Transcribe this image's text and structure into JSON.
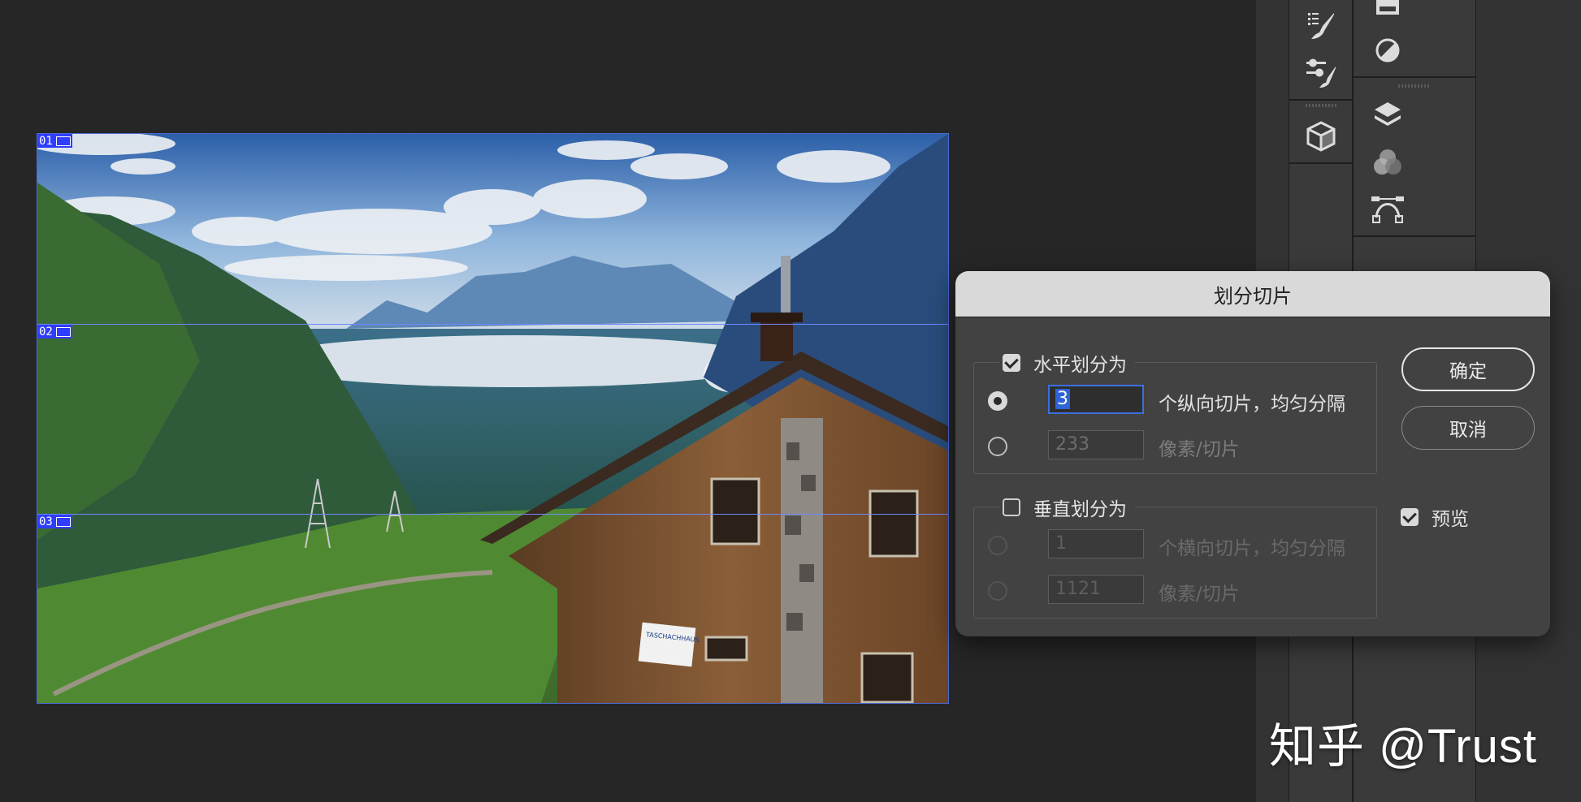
{
  "canvas": {
    "slices": [
      {
        "label": "01"
      },
      {
        "label": "02"
      },
      {
        "label": "03"
      }
    ],
    "sign_text": "TASCHACHHAUS"
  },
  "dialog": {
    "title": "划分切片",
    "horizontal": {
      "label": "水平划分为",
      "checked": true,
      "count_value": "3",
      "count_label": "个纵向切片，均匀分隔",
      "pixel_value": "233",
      "pixel_label": "像素/切片"
    },
    "vertical": {
      "label": "垂直划分为",
      "checked": false,
      "count_value": "1",
      "count_label": "个横向切片，均匀分隔",
      "pixel_value": "1121",
      "pixel_label": "像素/切片"
    },
    "ok_label": "确定",
    "cancel_label": "取消",
    "preview_label": "预览",
    "preview_checked": true
  },
  "tools": [
    {
      "icon": "brush-presets-icon"
    },
    {
      "icon": "brush-settings-icon"
    },
    {
      "icon": "3d-cube-icon"
    },
    {
      "icon": "swatches-icon"
    },
    {
      "icon": "adjustments-icon"
    },
    {
      "icon": "layers-icon"
    },
    {
      "icon": "channels-icon"
    },
    {
      "icon": "paths-icon"
    }
  ],
  "watermark": "知乎 @Trust",
  "colors": {
    "slice_blue": "#2f3dff",
    "accent_focus": "#3b6fe0",
    "dialog_bg": "#424242",
    "app_bg": "#262626"
  }
}
